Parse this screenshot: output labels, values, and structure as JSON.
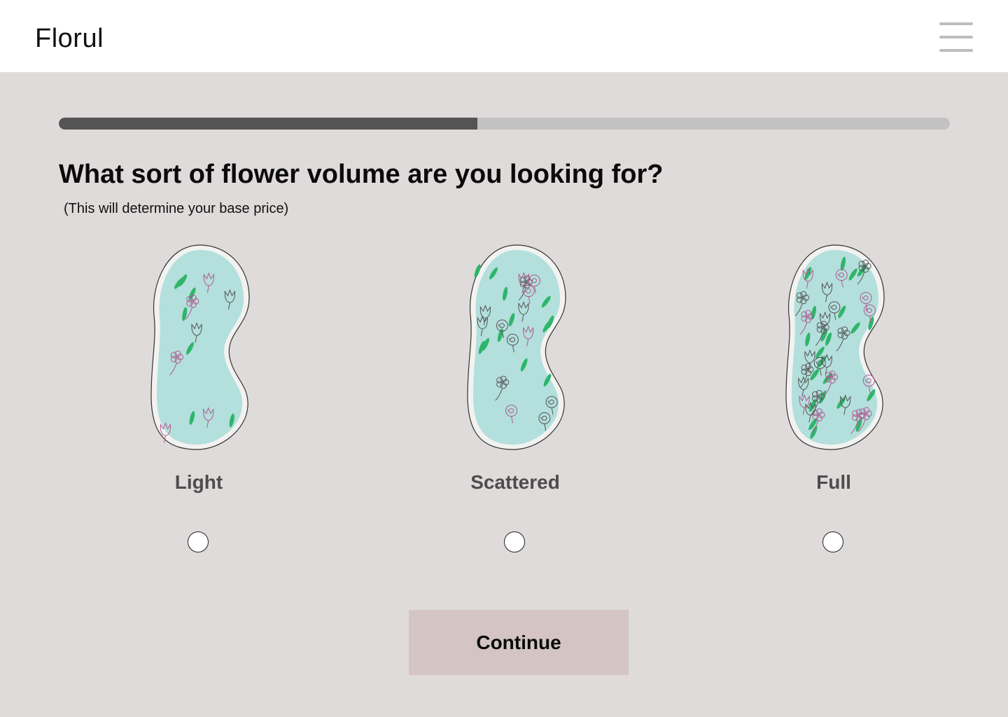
{
  "header": {
    "brand": "Florul",
    "menu_icon": "hamburger-menu-icon"
  },
  "progress": {
    "fraction": 0.47
  },
  "question": {
    "title": "What sort of flower volume are you looking for?",
    "note": "(This will determine your base price)"
  },
  "options": [
    {
      "label": "Light",
      "density": "light",
      "selected": false
    },
    {
      "label": "Scattered",
      "density": "scattered",
      "selected": false
    },
    {
      "label": "Full",
      "density": "full",
      "selected": false
    }
  ],
  "colors": {
    "page_bg": "#dfdbda",
    "bean_fill": "#b3dfdc",
    "leaf": "#2fb56a",
    "flower_stroke": "#b0598f",
    "button_bg": "#d4c4c4",
    "progress_fill": "#545454",
    "progress_track": "#c2c2c2"
  },
  "continue_button": {
    "label": "Continue"
  }
}
